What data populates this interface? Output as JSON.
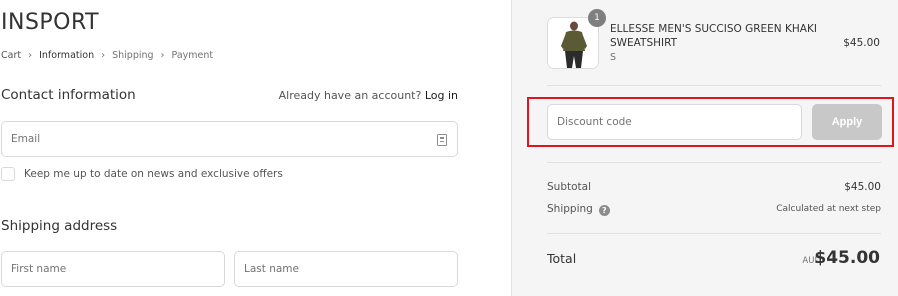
{
  "header": {
    "logo": "INSPORT"
  },
  "breadcrumb": [
    "Cart",
    "Information",
    "Shipping",
    "Payment"
  ],
  "contact": {
    "title": "Contact information",
    "account_prompt": "Already have an account?",
    "login_link": "Log in",
    "email_placeholder": "Email",
    "newsletter_label": "Keep me up to date on news and exclusive offers"
  },
  "shipping": {
    "title": "Shipping address",
    "first_name_placeholder": "First name",
    "last_name_placeholder": "Last name"
  },
  "order": {
    "item": {
      "name": "ELLESSE MEN'S SUCCISO GREEN KHAKI SWEATSHIRT",
      "variant": "S",
      "price": "$45.00",
      "quantity": "1"
    },
    "discount_placeholder": "Discount code",
    "apply_label": "Apply",
    "subtotal_label": "Subtotal",
    "subtotal_value": "$45.00",
    "shipping_label": "Shipping",
    "shipping_value": "Calculated at next step",
    "total_label": "Total",
    "currency": "AUD",
    "total_value": "$45.00"
  },
  "colors": {
    "highlight": "#e0141e",
    "apply_disabled": "#c8c8c8",
    "summary_bg": "#f5f5f5"
  }
}
